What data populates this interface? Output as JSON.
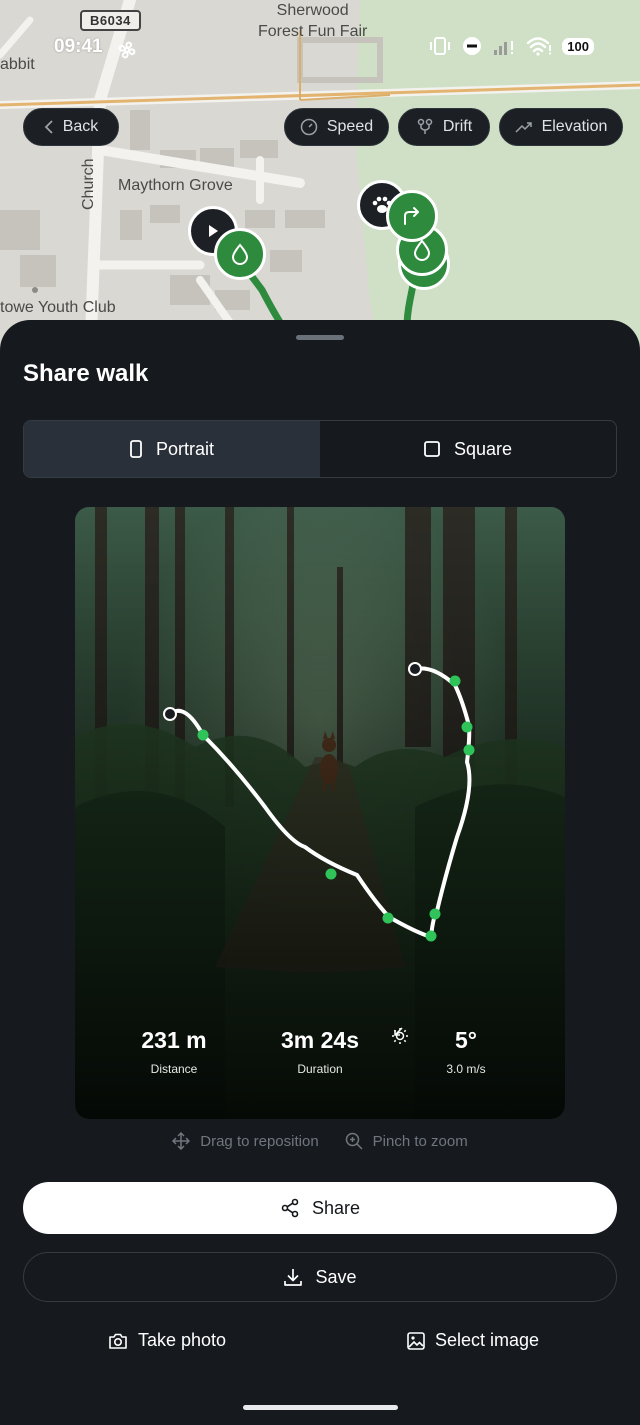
{
  "status_bar": {
    "time": "09:41",
    "battery": "100"
  },
  "map": {
    "road_shield": "B6034",
    "labels": {
      "fair": "Sherwood\nForest Fun Fair",
      "street": "Maythorn Grove",
      "church": "Church",
      "club": "towe Youth Club",
      "rabbit": "abbit"
    }
  },
  "map_controls": {
    "back": "Back",
    "speed": "Speed",
    "drift": "Drift",
    "elevation": "Elevation"
  },
  "sheet": {
    "title": "Share walk",
    "formats": [
      {
        "label": "Portrait",
        "icon": "portrait-icon",
        "selected": true
      },
      {
        "label": "Square",
        "icon": "square-icon",
        "selected": false
      }
    ]
  },
  "preview": {
    "distance_value": "231 m",
    "distance_label": "Distance",
    "duration_value": "3m 24s",
    "duration_label": "Duration",
    "temperature_value": "5°",
    "wind_label": "3.0 m/s",
    "weather_icon": "sun-icon",
    "wind_icon": "wind-direction-arrow-icon",
    "route_color": "#ffffff",
    "waypoint_color": "#2fc35a"
  },
  "hints": {
    "drag": "Drag to reposition",
    "pinch": "Pinch to zoom"
  },
  "actions": {
    "share": "Share",
    "save": "Save",
    "take_photo": "Take photo",
    "select_image": "Select image"
  },
  "colors": {
    "background": "#161a1f",
    "segment_active": "#2a3039",
    "map_marker_green": "#2e8b3d"
  }
}
